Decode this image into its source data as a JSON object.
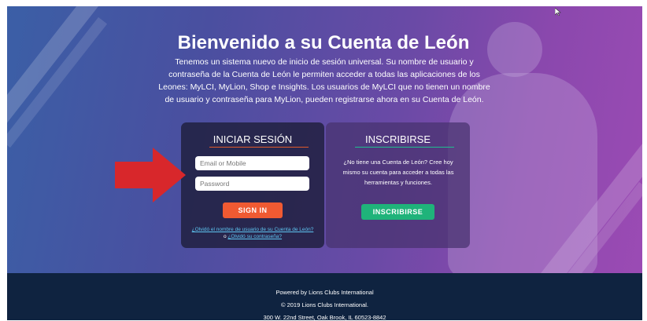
{
  "hero": {
    "title": "Bienvenido a su Cuenta de León",
    "intro": "Tenemos un sistema nuevo de inicio de sesión universal. Su nombre de usuario y contraseña de la Cuenta de León le permiten acceder a todas las aplicaciones de los Leones: MyLCI, MyLion, Shop e Insights. Los usuarios de MyLCI que no tienen un nombre de usuario y contraseña para MyLion, pueden registrarse ahora en su Cuenta de León."
  },
  "login": {
    "title": "INICIAR SESIÓN",
    "email_placeholder": "Email or Mobile",
    "email_value": "",
    "password_placeholder": "Password",
    "password_value": "",
    "signin_label": "SIGN IN",
    "forgot_username": "¿Olvidó el nombre de usuario de su Cuenta de León?",
    "or": "o",
    "forgot_password": "¿Olvidó su contraseña?",
    "accent_color": "#f05a32"
  },
  "signup": {
    "title": "INSCRIBIRSE",
    "text": "¿No tiene una Cuenta de León? Cree hoy mismo su cuenta para acceder a todas las herramientas y funciones.",
    "button_label": "INSCRIBIRSE",
    "accent_color": "#1fb37a"
  },
  "annotation": {
    "arrow_color": "#d8272b",
    "arrow_icon": "red-arrow-right"
  },
  "footer": {
    "line1": "Powered by Lions Clubs International",
    "line2": "© 2019 Lions Clubs International.",
    "line3": "300 W. 22nd Street, Oak Brook, IL 60523-8842"
  }
}
